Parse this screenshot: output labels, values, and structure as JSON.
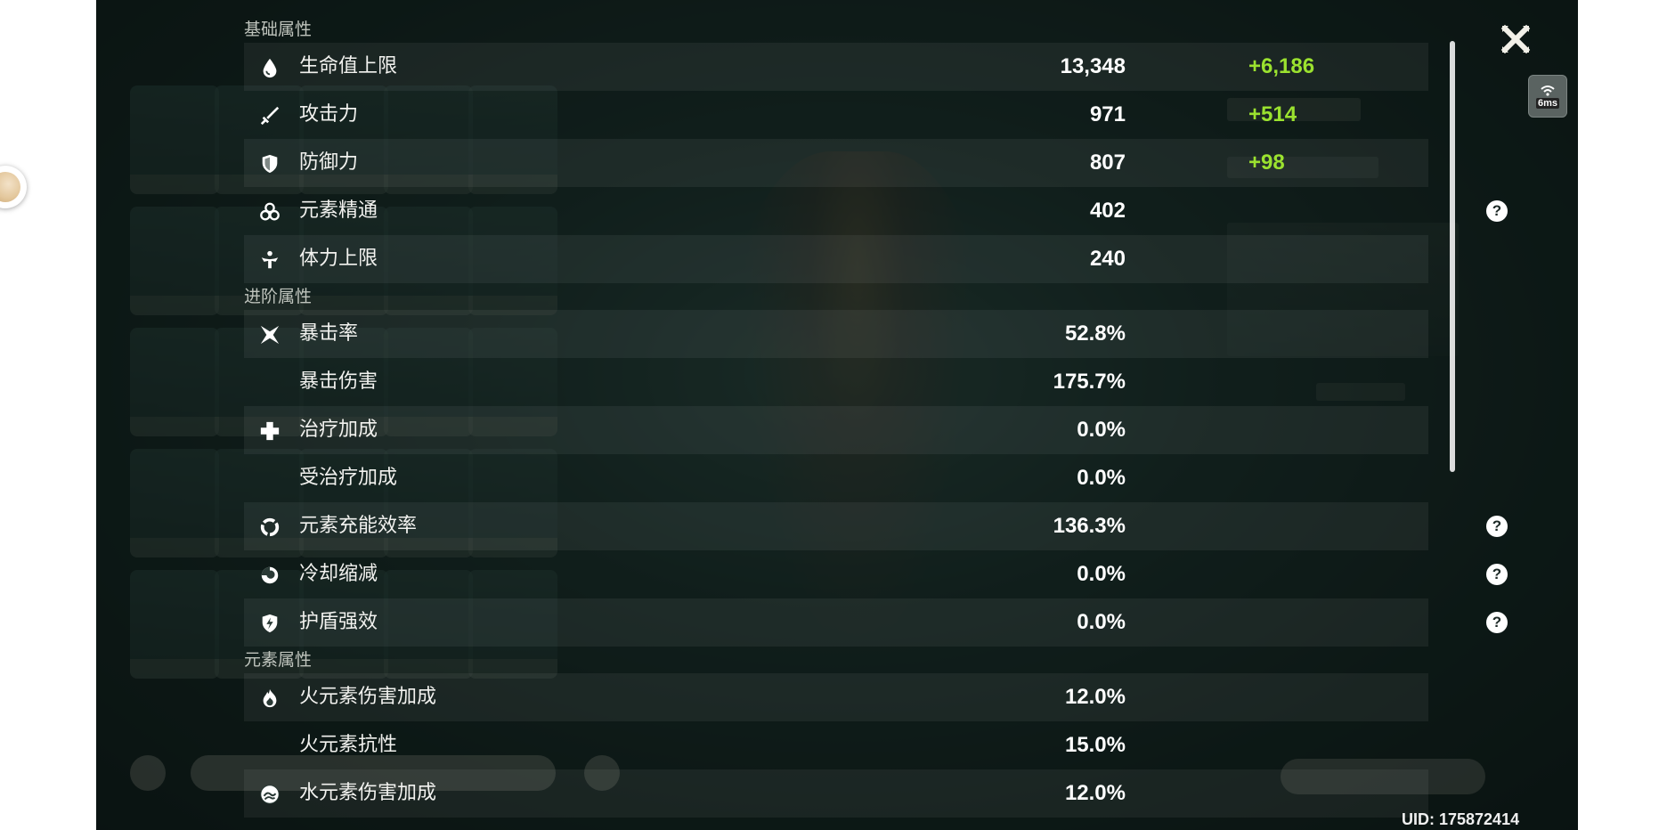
{
  "sections": {
    "base": {
      "title": "基础属性",
      "rows": [
        {
          "icon": "drop-icon",
          "name": "生命值上限",
          "value": "13,348",
          "bonus": "+6,186",
          "help": false
        },
        {
          "icon": "sword-icon",
          "name": "攻击力",
          "value": "971",
          "bonus": "+514",
          "help": false
        },
        {
          "icon": "shield-icon",
          "name": "防御力",
          "value": "807",
          "bonus": "+98",
          "help": false
        },
        {
          "icon": "elemental-mastery-icon",
          "name": "元素精通",
          "value": "402",
          "bonus": "",
          "help": true
        },
        {
          "icon": "stamina-icon",
          "name": "体力上限",
          "value": "240",
          "bonus": "",
          "help": false
        }
      ]
    },
    "advanced": {
      "title": "进阶属性",
      "rows": [
        {
          "icon": "crit-icon",
          "name": "暴击率",
          "value": "52.8%",
          "help": false
        },
        {
          "icon": "",
          "name": "暴击伤害",
          "value": "175.7%",
          "help": false
        },
        {
          "icon": "healing-cross-icon",
          "name": "治疗加成",
          "value": "0.0%",
          "help": false
        },
        {
          "icon": "",
          "name": "受治疗加成",
          "value": "0.0%",
          "help": false
        },
        {
          "icon": "energy-recharge-icon",
          "name": "元素充能效率",
          "value": "136.3%",
          "help": true
        },
        {
          "icon": "cooldown-icon",
          "name": "冷却缩减",
          "value": "0.0%",
          "help": true
        },
        {
          "icon": "shield-strength-icon",
          "name": "护盾强效",
          "value": "0.0%",
          "help": true
        }
      ]
    },
    "elemental": {
      "title": "元素属性",
      "rows": [
        {
          "icon": "pyro-icon",
          "name": "火元素伤害加成",
          "value": "12.0%",
          "help": false
        },
        {
          "icon": "",
          "name": "火元素抗性",
          "value": "15.0%",
          "help": false
        },
        {
          "icon": "hydro-icon",
          "name": "水元素伤害加成",
          "value": "12.0%",
          "help": false
        }
      ]
    }
  },
  "help_glyph": "?",
  "ping": {
    "value": "6ms"
  },
  "uid": "UID: 175872414",
  "colors": {
    "bonus": "#9be22f",
    "text": "#f2f2ef",
    "section": "#bfc4bd"
  }
}
